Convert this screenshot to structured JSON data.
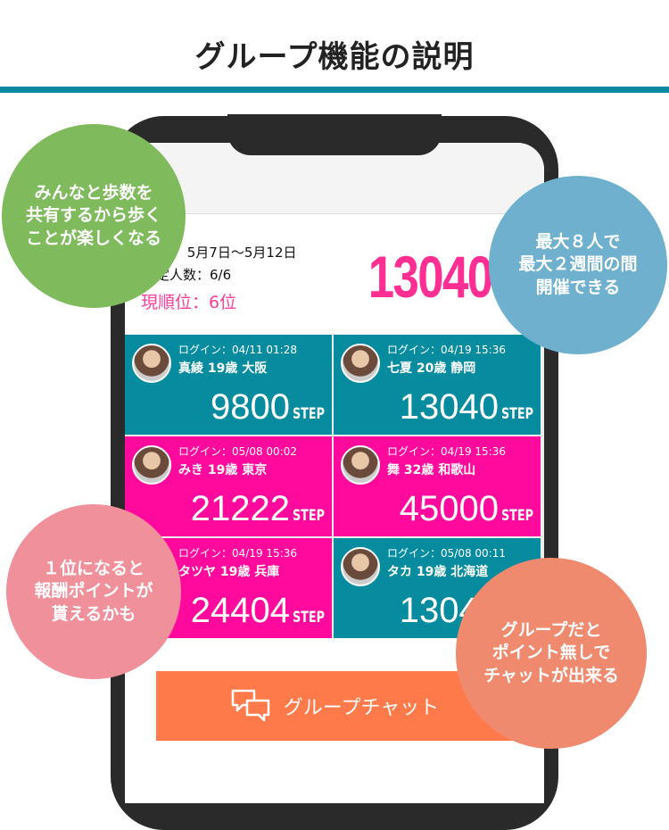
{
  "title": "グループ機能の説明",
  "app": {
    "period": "期間： 5月7日〜5月12日",
    "members": "決定人数：6/6",
    "rank": "現順位：6位",
    "my_steps": "13040",
    "step_unit": "STEP",
    "cards": [
      {
        "login": "ログイン：04/11 01:28",
        "name": "真綾 19歳 大阪",
        "steps": "9800",
        "color": "teal"
      },
      {
        "login": "ログイン：04/19 15:36",
        "name": "七夏 20歳 静岡",
        "steps": "13040",
        "color": "teal"
      },
      {
        "login": "ログイン：05/08 00:02",
        "name": "みき 19歳 東京",
        "steps": "21222",
        "color": "pink"
      },
      {
        "login": "ログイン：04/19 15:36",
        "name": "舞 32歳 和歌山",
        "steps": "45000",
        "color": "pink"
      },
      {
        "login": "ログイン：04/19 15:36",
        "name": "タツヤ 19歳 兵庫",
        "steps": "24404",
        "color": "pink"
      },
      {
        "login": "ログイン：05/08 00:11",
        "name": "タカ 19歳 北海道",
        "steps": "13040",
        "color": "teal"
      }
    ],
    "chat_button": "グループチャット"
  },
  "bubbles": {
    "share": "みんなと歩数を\n共有するから歩く\nことが楽しくなる",
    "size": "最大８人で\n最大２週間の間\n開催できる",
    "reward": "１位になると\n報酬ポイントが\n貰えるかも",
    "chat": "グループだと\nポイント無しで\nチャットが出来る"
  }
}
